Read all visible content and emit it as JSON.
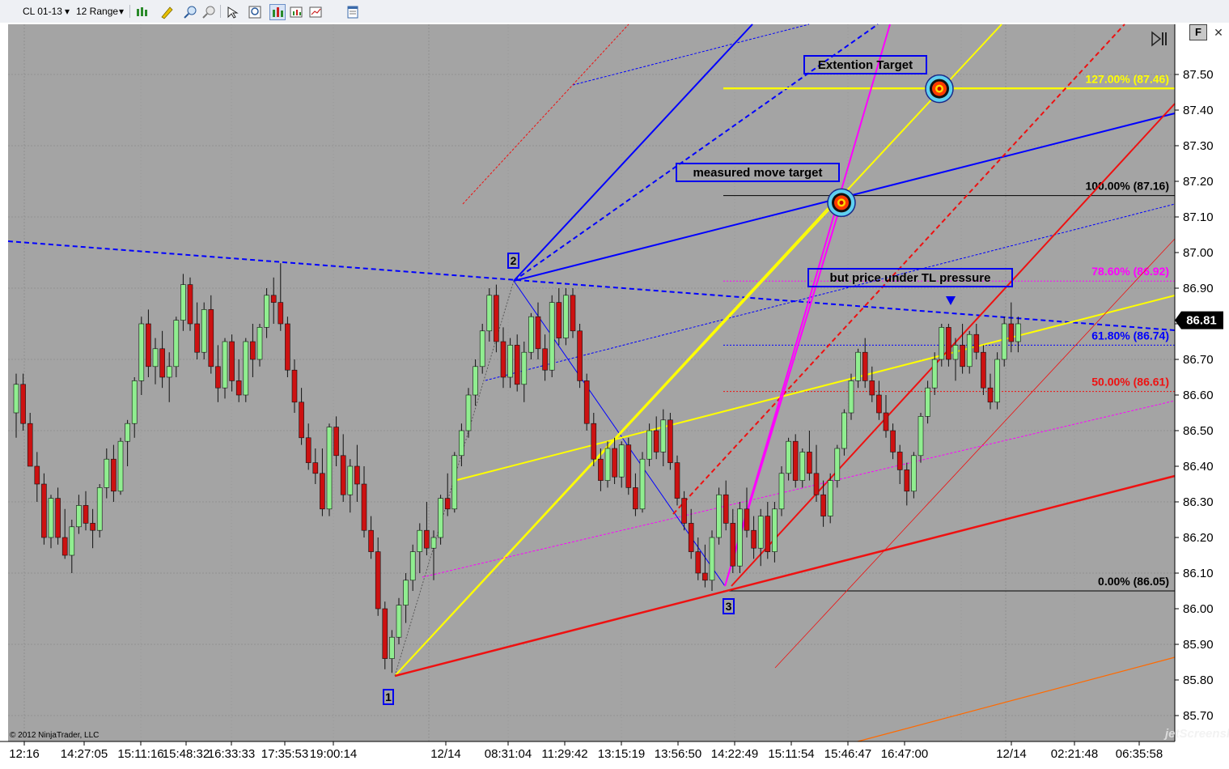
{
  "toolbar": {
    "instrument": "CL 01-13",
    "bar_type": "12 Range",
    "icons": [
      "candlestick-style-icon",
      "draw-pencil-icon",
      "zoom-in-icon",
      "zoom-out-icon",
      "cursor-icon",
      "search-zoom-icon",
      "bar-chart-icon",
      "data-box-icon",
      "indicator-icon",
      "properties-icon"
    ]
  },
  "panel": {
    "f_label": "F",
    "copyright": "© 2012 NinjaTrader, LLC",
    "watermark": "jetScreenshot"
  },
  "price_axis": {
    "min": 85.65,
    "max": 87.66,
    "ticks": [
      "87.50",
      "87.40",
      "87.30",
      "87.20",
      "87.10",
      "87.00",
      "86.90",
      "86.80",
      "86.70",
      "86.60",
      "86.50",
      "86.40",
      "86.30",
      "86.20",
      "86.10",
      "86.00",
      "85.90",
      "85.80",
      "85.70"
    ],
    "current_price": "86.81"
  },
  "time_axis": [
    "12:16",
    "14:27:05",
    "15:11:16",
    "15:48:32",
    "16:33:33",
    "17:35:53",
    "19:00:14",
    "12/14",
    "08:31:04",
    "11:29:42",
    "13:15:19",
    "13:56:50",
    "14:22:49",
    "15:11:54",
    "15:46:47",
    "16:47:00",
    "12/14",
    "02:21:48",
    "06:35:58"
  ],
  "fib_levels": [
    {
      "label": "127.00% (87.46)",
      "price": 87.46,
      "color": "#ffff00"
    },
    {
      "label": "100.00% (87.16)",
      "price": 87.16,
      "color": "#000000"
    },
    {
      "label": "78.60% (86.92)",
      "price": 86.92,
      "color": "#ff00ff"
    },
    {
      "label": "61.80% (86.74)",
      "price": 86.74,
      "color": "#0000ff"
    },
    {
      "label": "50.00% (86.61)",
      "price": 86.61,
      "color": "#ee1111"
    },
    {
      "label": "0.00% (86.05)",
      "price": 86.05,
      "color": "#000000"
    }
  ],
  "annotations": {
    "extension_target": "Extention Target",
    "measured_move_target": "measured move target",
    "tl_pressure": "but price under TL pressure",
    "pivot_1": "1",
    "pivot_2": "2",
    "pivot_3": "3"
  },
  "colors": {
    "chart_bg": "#a4a4a4",
    "up_candle": "#90ee90",
    "down_candle": "#cc1111",
    "trendline_blue": "#0000ff",
    "trendline_red": "#ee1111",
    "trendline_yellow": "#ffff00",
    "trendline_magenta": "#ff00ff"
  },
  "chart_data": {
    "type": "candlestick",
    "instrument": "CL 01-13",
    "bar_type": "12 Range",
    "y_range": [
      85.65,
      87.66
    ],
    "pivots": [
      {
        "label": "1",
        "price": 85.82
      },
      {
        "label": "2",
        "price": 86.92
      },
      {
        "label": "3",
        "price": 86.05
      }
    ],
    "targets": [
      {
        "label": "measured move target",
        "price": 87.14
      },
      {
        "label": "Extention Target",
        "price": 87.46
      }
    ],
    "last_price": 86.81,
    "ohlc_note_free": true,
    "candles": [
      {
        "o": 86.55,
        "h": 86.66,
        "l": 86.48,
        "c": 86.63
      },
      {
        "o": 86.63,
        "h": 86.66,
        "l": 86.5,
        "c": 86.52
      },
      {
        "o": 86.52,
        "h": 86.55,
        "l": 86.4,
        "c": 86.4
      },
      {
        "o": 86.4,
        "h": 86.44,
        "l": 86.3,
        "c": 86.35
      },
      {
        "o": 86.35,
        "h": 86.38,
        "l": 86.18,
        "c": 86.2
      },
      {
        "o": 86.2,
        "h": 86.32,
        "l": 86.17,
        "c": 86.31
      },
      {
        "o": 86.31,
        "h": 86.34,
        "l": 86.18,
        "c": 86.2
      },
      {
        "o": 86.2,
        "h": 86.28,
        "l": 86.14,
        "c": 86.15
      },
      {
        "o": 86.15,
        "h": 86.25,
        "l": 86.1,
        "c": 86.23
      },
      {
        "o": 86.23,
        "h": 86.32,
        "l": 86.21,
        "c": 86.29
      },
      {
        "o": 86.29,
        "h": 86.33,
        "l": 86.22,
        "c": 86.24
      },
      {
        "o": 86.24,
        "h": 86.28,
        "l": 86.17,
        "c": 86.22
      },
      {
        "o": 86.22,
        "h": 86.35,
        "l": 86.2,
        "c": 86.34
      },
      {
        "o": 86.34,
        "h": 86.45,
        "l": 86.31,
        "c": 86.42
      },
      {
        "o": 86.42,
        "h": 86.46,
        "l": 86.3,
        "c": 86.33
      },
      {
        "o": 86.33,
        "h": 86.48,
        "l": 86.32,
        "c": 86.47
      },
      {
        "o": 86.47,
        "h": 86.53,
        "l": 86.4,
        "c": 86.52
      },
      {
        "o": 86.52,
        "h": 86.65,
        "l": 86.48,
        "c": 86.64
      },
      {
        "o": 86.64,
        "h": 86.82,
        "l": 86.6,
        "c": 86.8
      },
      {
        "o": 86.8,
        "h": 86.84,
        "l": 86.65,
        "c": 86.68
      },
      {
        "o": 86.68,
        "h": 86.76,
        "l": 86.63,
        "c": 86.73
      },
      {
        "o": 86.73,
        "h": 86.78,
        "l": 86.62,
        "c": 86.65
      },
      {
        "o": 86.65,
        "h": 86.72,
        "l": 86.58,
        "c": 86.68
      },
      {
        "o": 86.68,
        "h": 86.82,
        "l": 86.65,
        "c": 86.81
      },
      {
        "o": 86.81,
        "h": 86.94,
        "l": 86.78,
        "c": 86.91
      },
      {
        "o": 86.91,
        "h": 86.93,
        "l": 86.78,
        "c": 86.8
      },
      {
        "o": 86.8,
        "h": 86.86,
        "l": 86.7,
        "c": 86.72
      },
      {
        "o": 86.72,
        "h": 86.86,
        "l": 86.7,
        "c": 86.84
      },
      {
        "o": 86.84,
        "h": 86.88,
        "l": 86.66,
        "c": 86.68
      },
      {
        "o": 86.68,
        "h": 86.74,
        "l": 86.58,
        "c": 86.62
      },
      {
        "o": 86.62,
        "h": 86.76,
        "l": 86.59,
        "c": 86.75
      },
      {
        "o": 86.75,
        "h": 86.77,
        "l": 86.61,
        "c": 86.64
      },
      {
        "o": 86.64,
        "h": 86.7,
        "l": 86.58,
        "c": 86.6
      },
      {
        "o": 86.6,
        "h": 86.76,
        "l": 86.58,
        "c": 86.75
      },
      {
        "o": 86.75,
        "h": 86.8,
        "l": 86.65,
        "c": 86.7
      },
      {
        "o": 86.7,
        "h": 86.8,
        "l": 86.68,
        "c": 86.79
      },
      {
        "o": 86.79,
        "h": 86.9,
        "l": 86.76,
        "c": 86.88
      },
      {
        "o": 86.88,
        "h": 86.93,
        "l": 86.8,
        "c": 86.86
      },
      {
        "o": 86.86,
        "h": 86.97,
        "l": 86.78,
        "c": 86.8
      },
      {
        "o": 86.8,
        "h": 86.82,
        "l": 86.65,
        "c": 86.67
      },
      {
        "o": 86.67,
        "h": 86.7,
        "l": 86.55,
        "c": 86.58
      },
      {
        "o": 86.58,
        "h": 86.62,
        "l": 86.46,
        "c": 86.48
      },
      {
        "o": 86.48,
        "h": 86.52,
        "l": 86.39,
        "c": 86.41
      },
      {
        "o": 86.41,
        "h": 86.45,
        "l": 86.35,
        "c": 86.38
      },
      {
        "o": 86.38,
        "h": 86.45,
        "l": 86.26,
        "c": 86.28
      },
      {
        "o": 86.28,
        "h": 86.52,
        "l": 86.26,
        "c": 86.51
      },
      {
        "o": 86.51,
        "h": 86.54,
        "l": 86.4,
        "c": 86.43
      },
      {
        "o": 86.43,
        "h": 86.49,
        "l": 86.3,
        "c": 86.32
      },
      {
        "o": 86.32,
        "h": 86.42,
        "l": 86.27,
        "c": 86.4
      },
      {
        "o": 86.4,
        "h": 86.46,
        "l": 86.3,
        "c": 86.35
      },
      {
        "o": 86.35,
        "h": 86.4,
        "l": 86.2,
        "c": 86.22
      },
      {
        "o": 86.22,
        "h": 86.26,
        "l": 86.14,
        "c": 86.16
      },
      {
        "o": 86.16,
        "h": 86.2,
        "l": 85.98,
        "c": 86.0
      },
      {
        "o": 86.0,
        "h": 86.02,
        "l": 85.83,
        "c": 85.86
      },
      {
        "o": 85.86,
        "h": 85.94,
        "l": 85.82,
        "c": 85.92
      },
      {
        "o": 85.92,
        "h": 86.03,
        "l": 85.9,
        "c": 86.01
      },
      {
        "o": 86.01,
        "h": 86.1,
        "l": 85.96,
        "c": 86.08
      },
      {
        "o": 86.08,
        "h": 86.18,
        "l": 86.05,
        "c": 86.16
      },
      {
        "o": 86.16,
        "h": 86.24,
        "l": 86.1,
        "c": 86.22
      },
      {
        "o": 86.22,
        "h": 86.3,
        "l": 86.15,
        "c": 86.17
      },
      {
        "o": 86.17,
        "h": 86.22,
        "l": 86.08,
        "c": 86.2
      },
      {
        "o": 86.2,
        "h": 86.32,
        "l": 86.18,
        "c": 86.31
      },
      {
        "o": 86.31,
        "h": 86.38,
        "l": 86.26,
        "c": 86.28
      },
      {
        "o": 86.28,
        "h": 86.44,
        "l": 86.27,
        "c": 86.43
      },
      {
        "o": 86.43,
        "h": 86.52,
        "l": 86.4,
        "c": 86.5
      },
      {
        "o": 86.5,
        "h": 86.62,
        "l": 86.48,
        "c": 86.6
      },
      {
        "o": 86.6,
        "h": 86.7,
        "l": 86.57,
        "c": 86.68
      },
      {
        "o": 86.68,
        "h": 86.8,
        "l": 86.66,
        "c": 86.78
      },
      {
        "o": 86.78,
        "h": 86.9,
        "l": 86.75,
        "c": 86.88
      },
      {
        "o": 86.88,
        "h": 86.91,
        "l": 86.72,
        "c": 86.75
      },
      {
        "o": 86.75,
        "h": 86.79,
        "l": 86.62,
        "c": 86.65
      },
      {
        "o": 86.65,
        "h": 86.76,
        "l": 86.62,
        "c": 86.74
      },
      {
        "o": 86.74,
        "h": 86.77,
        "l": 86.61,
        "c": 86.63
      },
      {
        "o": 86.63,
        "h": 86.75,
        "l": 86.58,
        "c": 86.72
      },
      {
        "o": 86.72,
        "h": 86.83,
        "l": 86.7,
        "c": 86.82
      },
      {
        "o": 86.82,
        "h": 86.86,
        "l": 86.7,
        "c": 86.73
      },
      {
        "o": 86.73,
        "h": 86.77,
        "l": 86.64,
        "c": 86.67
      },
      {
        "o": 86.67,
        "h": 86.88,
        "l": 86.65,
        "c": 86.86
      },
      {
        "o": 86.86,
        "h": 86.9,
        "l": 86.74,
        "c": 86.76
      },
      {
        "o": 86.76,
        "h": 86.9,
        "l": 86.74,
        "c": 86.88
      },
      {
        "o": 86.88,
        "h": 86.9,
        "l": 86.76,
        "c": 86.78
      },
      {
        "o": 86.78,
        "h": 86.8,
        "l": 86.62,
        "c": 86.64
      },
      {
        "o": 86.64,
        "h": 86.66,
        "l": 86.5,
        "c": 86.52
      },
      {
        "o": 86.52,
        "h": 86.55,
        "l": 86.4,
        "c": 86.42
      },
      {
        "o": 86.42,
        "h": 86.45,
        "l": 86.33,
        "c": 86.36
      },
      {
        "o": 86.36,
        "h": 86.47,
        "l": 86.34,
        "c": 86.45
      },
      {
        "o": 86.45,
        "h": 86.48,
        "l": 86.35,
        "c": 86.37
      },
      {
        "o": 86.37,
        "h": 86.47,
        "l": 86.34,
        "c": 86.46
      },
      {
        "o": 86.46,
        "h": 86.48,
        "l": 86.32,
        "c": 86.34
      },
      {
        "o": 86.34,
        "h": 86.38,
        "l": 86.26,
        "c": 86.28
      },
      {
        "o": 86.28,
        "h": 86.44,
        "l": 86.27,
        "c": 86.42
      },
      {
        "o": 86.42,
        "h": 86.52,
        "l": 86.4,
        "c": 86.5
      },
      {
        "o": 86.5,
        "h": 86.54,
        "l": 86.42,
        "c": 86.44
      },
      {
        "o": 86.44,
        "h": 86.56,
        "l": 86.4,
        "c": 86.53
      },
      {
        "o": 86.53,
        "h": 86.55,
        "l": 86.39,
        "c": 86.41
      },
      {
        "o": 86.41,
        "h": 86.43,
        "l": 86.29,
        "c": 86.31
      },
      {
        "o": 86.31,
        "h": 86.33,
        "l": 86.22,
        "c": 86.24
      },
      {
        "o": 86.24,
        "h": 86.28,
        "l": 86.14,
        "c": 86.16
      },
      {
        "o": 86.16,
        "h": 86.2,
        "l": 86.08,
        "c": 86.1
      },
      {
        "o": 86.1,
        "h": 86.18,
        "l": 86.06,
        "c": 86.08
      },
      {
        "o": 86.08,
        "h": 86.22,
        "l": 86.05,
        "c": 86.2
      },
      {
        "o": 86.2,
        "h": 86.34,
        "l": 86.18,
        "c": 86.32
      },
      {
        "o": 86.32,
        "h": 86.36,
        "l": 86.22,
        "c": 86.24
      },
      {
        "o": 86.24,
        "h": 86.28,
        "l": 86.1,
        "c": 86.12
      },
      {
        "o": 86.12,
        "h": 86.3,
        "l": 86.1,
        "c": 86.28
      },
      {
        "o": 86.28,
        "h": 86.34,
        "l": 86.2,
        "c": 86.22
      },
      {
        "o": 86.22,
        "h": 86.26,
        "l": 86.14,
        "c": 86.17
      },
      {
        "o": 86.17,
        "h": 86.28,
        "l": 86.12,
        "c": 86.26
      },
      {
        "o": 86.26,
        "h": 86.3,
        "l": 86.14,
        "c": 86.16
      },
      {
        "o": 86.16,
        "h": 86.3,
        "l": 86.13,
        "c": 86.28
      },
      {
        "o": 86.28,
        "h": 86.4,
        "l": 86.26,
        "c": 86.38
      },
      {
        "o": 86.38,
        "h": 86.48,
        "l": 86.36,
        "c": 86.47
      },
      {
        "o": 86.47,
        "h": 86.49,
        "l": 86.34,
        "c": 86.36
      },
      {
        "o": 86.36,
        "h": 86.45,
        "l": 86.34,
        "c": 86.44
      },
      {
        "o": 86.44,
        "h": 86.5,
        "l": 86.36,
        "c": 86.38
      },
      {
        "o": 86.38,
        "h": 86.46,
        "l": 86.3,
        "c": 86.32
      },
      {
        "o": 86.32,
        "h": 86.36,
        "l": 86.23,
        "c": 86.26
      },
      {
        "o": 86.26,
        "h": 86.38,
        "l": 86.24,
        "c": 86.36
      },
      {
        "o": 86.36,
        "h": 86.46,
        "l": 86.34,
        "c": 86.45
      },
      {
        "o": 86.45,
        "h": 86.56,
        "l": 86.43,
        "c": 86.55
      },
      {
        "o": 86.55,
        "h": 86.66,
        "l": 86.53,
        "c": 86.64
      },
      {
        "o": 86.64,
        "h": 86.73,
        "l": 86.62,
        "c": 86.72
      },
      {
        "o": 86.72,
        "h": 86.76,
        "l": 86.62,
        "c": 86.64
      },
      {
        "o": 86.64,
        "h": 86.68,
        "l": 86.58,
        "c": 86.6
      },
      {
        "o": 86.6,
        "h": 86.64,
        "l": 86.53,
        "c": 86.55
      },
      {
        "o": 86.55,
        "h": 86.6,
        "l": 86.48,
        "c": 86.5
      },
      {
        "o": 86.5,
        "h": 86.52,
        "l": 86.42,
        "c": 86.44
      },
      {
        "o": 86.44,
        "h": 86.46,
        "l": 86.35,
        "c": 86.39
      },
      {
        "o": 86.39,
        "h": 86.41,
        "l": 86.29,
        "c": 86.33
      },
      {
        "o": 86.33,
        "h": 86.44,
        "l": 86.31,
        "c": 86.43
      },
      {
        "o": 86.43,
        "h": 86.55,
        "l": 86.41,
        "c": 86.54
      },
      {
        "o": 86.54,
        "h": 86.64,
        "l": 86.52,
        "c": 86.62
      },
      {
        "o": 86.62,
        "h": 86.72,
        "l": 86.6,
        "c": 86.7
      },
      {
        "o": 86.7,
        "h": 86.8,
        "l": 86.68,
        "c": 86.79
      },
      {
        "o": 86.79,
        "h": 86.8,
        "l": 86.68,
        "c": 86.7
      },
      {
        "o": 86.7,
        "h": 86.76,
        "l": 86.64,
        "c": 86.74
      },
      {
        "o": 86.74,
        "h": 86.8,
        "l": 86.66,
        "c": 86.68
      },
      {
        "o": 86.68,
        "h": 86.78,
        "l": 86.66,
        "c": 86.77
      },
      {
        "o": 86.77,
        "h": 86.8,
        "l": 86.7,
        "c": 86.72
      },
      {
        "o": 86.72,
        "h": 86.74,
        "l": 86.6,
        "c": 86.62
      },
      {
        "o": 86.62,
        "h": 86.66,
        "l": 86.56,
        "c": 86.58
      },
      {
        "o": 86.58,
        "h": 86.72,
        "l": 86.56,
        "c": 86.7
      },
      {
        "o": 86.7,
        "h": 86.82,
        "l": 86.68,
        "c": 86.8
      },
      {
        "o": 86.8,
        "h": 86.86,
        "l": 86.72,
        "c": 86.75
      },
      {
        "o": 86.75,
        "h": 86.82,
        "l": 86.72,
        "c": 86.8
      }
    ]
  }
}
